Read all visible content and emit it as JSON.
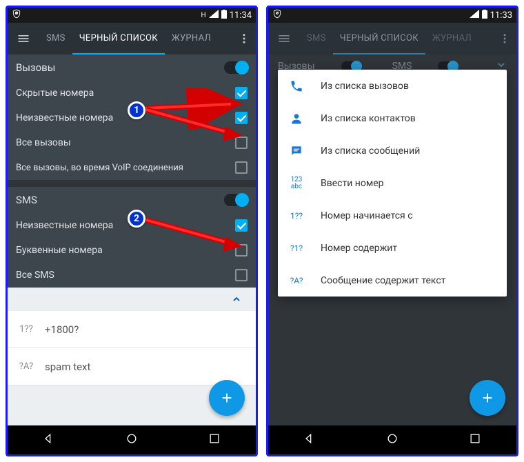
{
  "left": {
    "statusbar": {
      "time": "11:34"
    },
    "tabs": {
      "sms": "SMS",
      "blacklist": "ЧЕРНЫЙ СПИСОК",
      "journal": "ЖУРНАЛ"
    },
    "sections": {
      "calls_title": "Вызовы",
      "hidden_numbers": "Скрытые номера",
      "unknown_numbers": "Неизвестные номера",
      "all_calls": "Все вызовы",
      "all_calls_voip": "Все вызовы, во время VoIP соединения",
      "sms_title": "SMS",
      "unknown_numbers_sms": "Неизвестные номера",
      "letter_numbers": "Буквенные номера",
      "all_sms": "Все SMS"
    },
    "list": {
      "item1_prefix": "1??",
      "item1_text": "+1800?",
      "item2_prefix": "?A?",
      "item2_text": "spam text"
    },
    "annotations": {
      "badge1": "1",
      "badge2": "2"
    }
  },
  "right": {
    "statusbar": {
      "time": "11:33"
    },
    "tabs": {
      "sms": "SMS",
      "blacklist": "ЧЕРНЫЙ СПИСОК",
      "journal": "ЖУРНАЛ"
    },
    "dim_header": {
      "calls": "Вызовы",
      "sms": "SMS"
    },
    "menu": {
      "from_calls": "Из списка вызовов",
      "from_contacts": "Из списка контактов",
      "from_messages": "Из списка сообщений",
      "enter_number": "Ввести номер",
      "enter_number_icon": "123\nabc",
      "starts_with": "Номер начинается с",
      "starts_with_icon": "1??",
      "contains": "Номер содержит",
      "contains_icon": "?1?",
      "message_contains": "Сообщение содержит текст",
      "message_contains_icon": "?A?"
    }
  }
}
